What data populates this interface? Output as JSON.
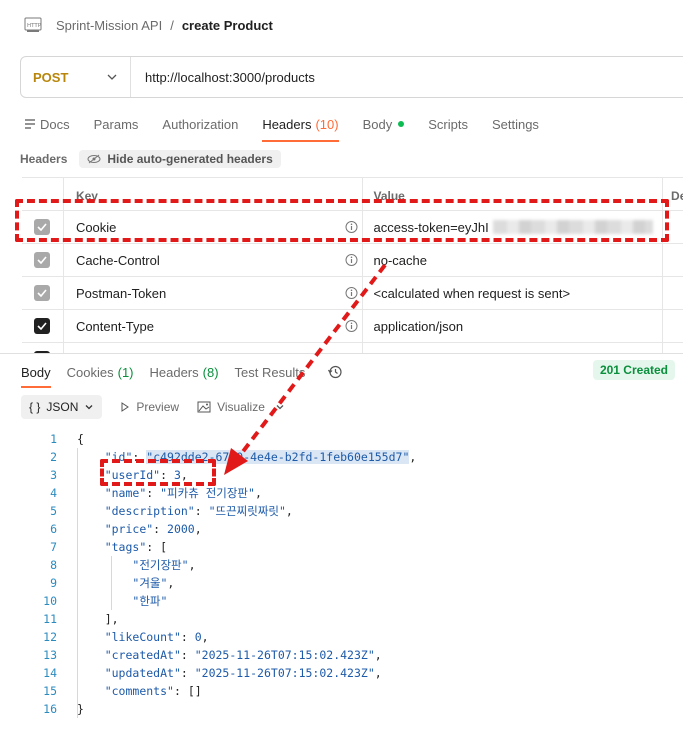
{
  "breadcrumb": {
    "collection": "Sprint-Mission API",
    "separator": "/",
    "request": "create Product"
  },
  "request": {
    "method": "POST",
    "url": "http://localhost:3000/products",
    "method_color": "#b8860b"
  },
  "request_tabs": [
    {
      "label": "Docs"
    },
    {
      "label": "Params"
    },
    {
      "label": "Authorization"
    },
    {
      "label": "Headers",
      "count": "(10)"
    },
    {
      "label": "Body"
    },
    {
      "label": "Scripts"
    },
    {
      "label": "Settings"
    }
  ],
  "headers_section": {
    "label": "Headers",
    "hide_button": "Hide auto-generated headers",
    "columns": {
      "key": "Key",
      "value": "Value",
      "description": "De"
    },
    "rows": [
      {
        "key": "Cookie",
        "value": "access-token=eyJhI",
        "checked": "gray"
      },
      {
        "key": "Cache-Control",
        "value": "no-cache",
        "checked": "gray"
      },
      {
        "key": "Postman-Token",
        "value": "<calculated when request is sent>",
        "checked": "gray"
      },
      {
        "key": "Content-Type",
        "value": "application/json",
        "checked": "dark"
      }
    ]
  },
  "response": {
    "tabs": [
      {
        "label": "Body"
      },
      {
        "label": "Cookies",
        "count": "(1)"
      },
      {
        "label": "Headers",
        "count": "(8)"
      },
      {
        "label": "Test Results"
      }
    ],
    "status": "201 Created",
    "format": "JSON",
    "format_icon": "{ }",
    "preview": "Preview",
    "visualize": "Visualize",
    "code_lines": [
      {
        "n": "1",
        "text": "{"
      },
      {
        "n": "2",
        "key": "\"id\"",
        "value": "\"c492dde2-6720-4e4e-b2fd-1feb60e155d7\""
      },
      {
        "n": "3",
        "key": "\"userId\"",
        "value": "3"
      },
      {
        "n": "4",
        "key": "\"name\"",
        "value": "\"피카츄 전기장판\""
      },
      {
        "n": "5",
        "key": "\"description\"",
        "value": "\"뜨끈찌릿짜릿\""
      },
      {
        "n": "6",
        "key": "\"price\"",
        "value": "2000"
      },
      {
        "n": "7",
        "key": "\"tags\"",
        "value": "["
      },
      {
        "n": "8",
        "value": "\"전기장판\""
      },
      {
        "n": "9",
        "value": "\"겨울\""
      },
      {
        "n": "10",
        "value": "\"한파\""
      },
      {
        "n": "11",
        "text": "],"
      },
      {
        "n": "12",
        "key": "\"likeCount\"",
        "value": "0"
      },
      {
        "n": "13",
        "key": "\"createdAt\"",
        "value": "\"2025-11-26T07:15:02.423Z\""
      },
      {
        "n": "14",
        "key": "\"updatedAt\"",
        "value": "\"2025-11-26T07:15:02.423Z\""
      },
      {
        "n": "15",
        "key": "\"comments\"",
        "value": "[]"
      },
      {
        "n": "16",
        "text": "}"
      }
    ]
  },
  "colors": {
    "accent": "#ff6c37",
    "success": "#0a8f3c",
    "annotation": "#e11919"
  }
}
